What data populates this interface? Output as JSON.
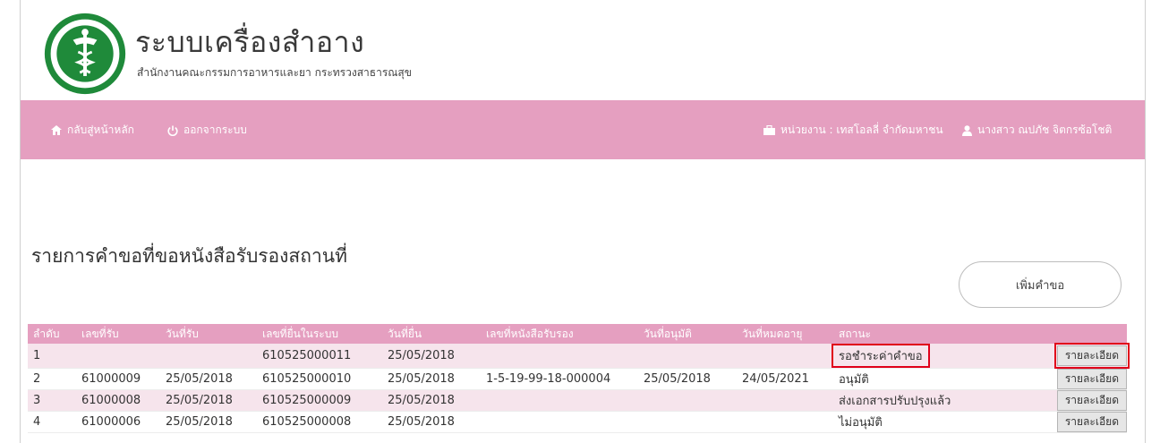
{
  "app": {
    "title": "ระบบเครื่องสำอาง",
    "subtitle": "สำนักงานคณะกรรมการอาหารและยา กระทรวงสาธารณสุข",
    "logo_text": "กระทรวงสาธารณสุข MINISTRY OF PUBLIC HEALTH"
  },
  "nav": {
    "home_label": "กลับสู่หน้าหลัก",
    "logout_label": "ออกจากระบบ",
    "unit_label": "หน่วยงาน : เทสโอลลี่ จำกัดมหาชน",
    "user_label": "นางสาว ณปภัช จิตกรซ้อโชติ"
  },
  "page": {
    "heading": "รายการคำขอที่ขอหนังสือรับรองสถานที่",
    "add_button_label": "เพิ่มคำขอ"
  },
  "table": {
    "headers": [
      "ลำดับ",
      "เลขที่รับ",
      "วันที่รับ",
      "เลขที่ยื่นในระบบ",
      "วันที่ยื่น",
      "เลขที่หนังสือรับรอง",
      "วันที่อนุมัติ",
      "วันที่หมดอายุ",
      "สถานะ",
      ""
    ],
    "detail_label": "รายละเอียด",
    "rows": [
      {
        "no": "1",
        "receive_no": "",
        "receive_date": "",
        "system_no": "610525000011",
        "submit_date": "25/05/2018",
        "cert_no": "",
        "approve_date": "",
        "expire_date": "",
        "status": "รอชำระค่าคำขอ",
        "highlight": true
      },
      {
        "no": "2",
        "receive_no": "61000009",
        "receive_date": "25/05/2018",
        "system_no": "610525000010",
        "submit_date": "25/05/2018",
        "cert_no": "1-5-19-99-18-000004",
        "approve_date": "25/05/2018",
        "expire_date": "24/05/2021",
        "status": "อนุมัติ",
        "highlight": false
      },
      {
        "no": "3",
        "receive_no": "61000008",
        "receive_date": "25/05/2018",
        "system_no": "610525000009",
        "submit_date": "25/05/2018",
        "cert_no": "",
        "approve_date": "",
        "expire_date": "",
        "status": "ส่งเอกสารปรับปรุงแล้ว",
        "highlight": false
      },
      {
        "no": "4",
        "receive_no": "61000006",
        "receive_date": "25/05/2018",
        "system_no": "610525000008",
        "submit_date": "25/05/2018",
        "cert_no": "",
        "approve_date": "",
        "expire_date": "",
        "status": "ไม่อนุมัติ",
        "highlight": false
      }
    ]
  },
  "colors": {
    "accent": "#e59fc0",
    "row_tint": "#f6e4ec",
    "highlight": "#e0001a",
    "logo_green": "#1f8a3a"
  },
  "icons": {
    "home": "home-icon",
    "power": "power-icon",
    "briefcase": "briefcase-icon",
    "user": "user-icon",
    "logo": "ministry-logo"
  }
}
